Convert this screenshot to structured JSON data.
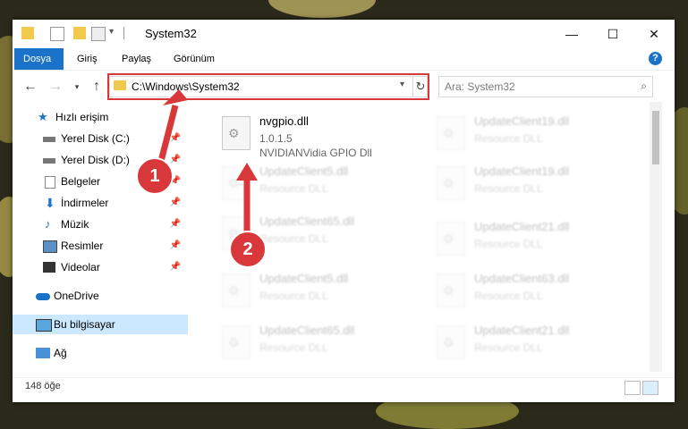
{
  "window": {
    "title": "System32"
  },
  "ribbon": {
    "tabs": [
      "Dosya",
      "Giriş",
      "Paylaş",
      "Görünüm"
    ]
  },
  "address": {
    "path": "C:\\Windows\\System32"
  },
  "search": {
    "placeholder": "Ara: System32"
  },
  "nav": {
    "items": [
      {
        "label": "Hızlı erişim",
        "icon": "star-icon"
      },
      {
        "label": "Yerel Disk (C:)",
        "icon": "drive-icon",
        "pinned": true
      },
      {
        "label": "Yerel Disk (D:)",
        "icon": "drive-icon",
        "pinned": true
      },
      {
        "label": "Belgeler",
        "icon": "documents-icon",
        "pinned": true
      },
      {
        "label": "İndirmeler",
        "icon": "downloads-icon",
        "pinned": true
      },
      {
        "label": "Müzik",
        "icon": "music-icon",
        "pinned": true
      },
      {
        "label": "Resimler",
        "icon": "pictures-icon",
        "pinned": true
      },
      {
        "label": "Videolar",
        "icon": "videos-icon",
        "pinned": true
      },
      {
        "label": "OneDrive",
        "icon": "cloud-icon"
      },
      {
        "label": "Bu bilgisayar",
        "icon": "computer-icon"
      },
      {
        "label": "Ağ",
        "icon": "network-icon"
      }
    ]
  },
  "files": {
    "main": {
      "name": "nvgpio.dll",
      "version": "1.0.1.5",
      "description": "NVIDIANVidia GPIO Dll"
    },
    "left": [
      {
        "name": "UpdateClient5.dll",
        "description": "Resource DLL"
      },
      {
        "name": "UpdateClient65.dll",
        "description": "Resource DLL"
      },
      {
        "name": "UpdateClient5.dll",
        "description": "Resource DLL"
      },
      {
        "name": "UpdateClient65.dll",
        "description": "Resource DLL"
      }
    ],
    "right": [
      {
        "name": "UpdateClient19.dll",
        "description": "Resource DLL"
      },
      {
        "name": "UpdateClient19.dll",
        "description": "Resource DLL"
      },
      {
        "name": "UpdateClient21.dll",
        "description": "Resource DLL"
      },
      {
        "name": "UpdateClient63.dll",
        "description": "Resource DLL"
      },
      {
        "name": "UpdateClient21.dll",
        "description": "Resource DLL"
      }
    ]
  },
  "status": {
    "count": "148 öğe"
  },
  "callouts": [
    "1",
    "2"
  ],
  "colors": {
    "accent": "#1a73c9",
    "highlight": "#d9383a",
    "selection": "#cce8ff"
  }
}
